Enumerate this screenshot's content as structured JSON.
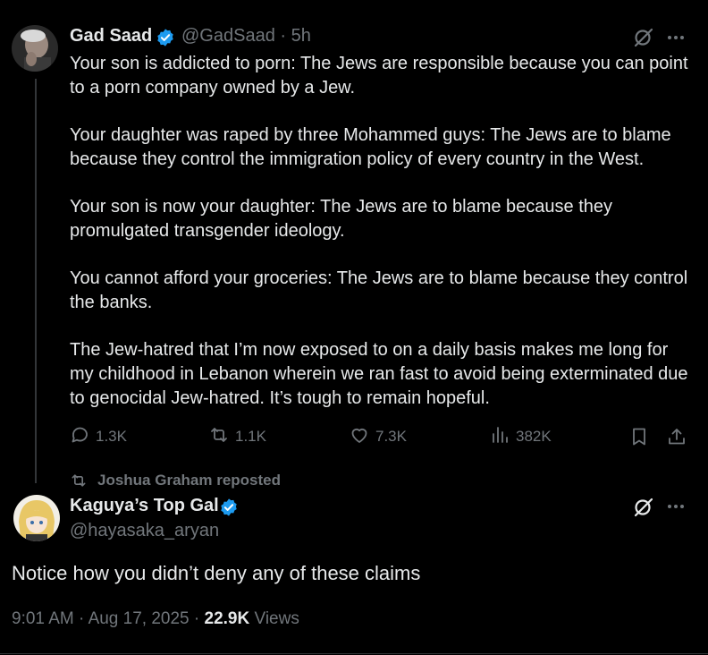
{
  "colors": {
    "background": "#000000",
    "text": "#e7e9ea",
    "muted": "#71767b",
    "verified": "#1d9bf0",
    "line": "#333639"
  },
  "parent_tweet": {
    "name": "Gad Saad",
    "handle": "@GadSaad",
    "dot": "·",
    "time": "5h",
    "paragraphs": [
      "Your son is addicted to porn: The Jews are responsible because you can point to a porn company owned by a Jew.",
      "Your daughter was raped by three Mohammed guys: The Jews are to blame because they control the immigration policy of every country in the West.",
      "Your son is now your daughter: The Jews are to blame because they promulgated transgender ideology.",
      "You cannot afford your groceries: The Jews are to blame because they control the banks.",
      "The Jew-hatred that I’m now exposed to on a daily basis makes me long for my childhood in Lebanon wherein we ran fast to avoid being exterminated due to genocidal Jew-hatred. It’s tough to remain hopeful."
    ],
    "actions": {
      "replies": "1.3K",
      "reposts": "1.1K",
      "likes": "7.3K",
      "views": "382K"
    },
    "icons": [
      "grok-icon",
      "more-icon",
      "reply-icon",
      "repost-icon",
      "like-icon",
      "views-icon",
      "bookmark-icon",
      "share-icon"
    ]
  },
  "repost_header": {
    "text": "Joshua Graham reposted"
  },
  "main_tweet": {
    "name": "Kaguya’s Top Gal",
    "handle": "@hayasaka_aryan",
    "text": "Notice how you didn’t deny any of these claims",
    "time": "9:01 AM",
    "sep1": "·",
    "date": "Aug 17, 2025",
    "sep2": "·",
    "views_count": "22.9K",
    "views_label": "Views"
  }
}
